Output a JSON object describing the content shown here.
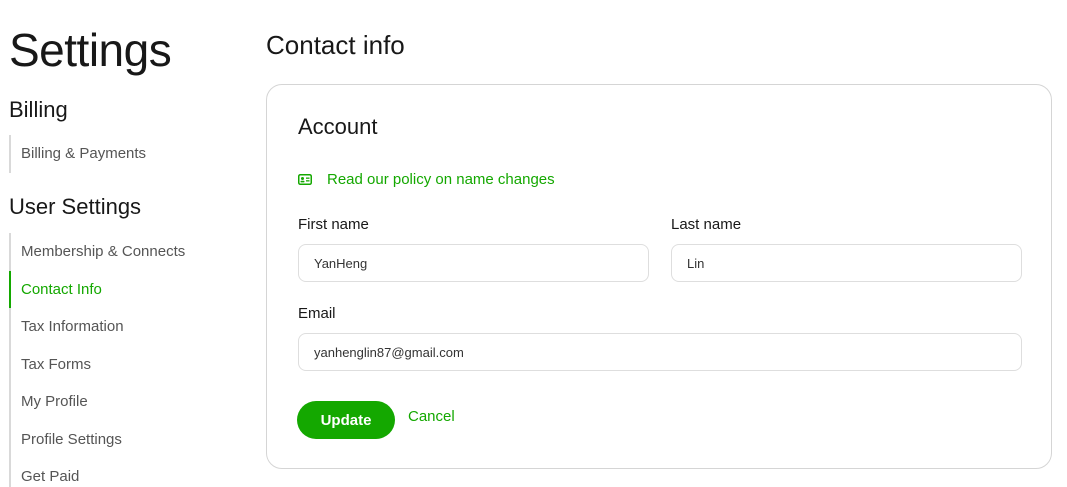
{
  "sidebar": {
    "title": "Settings",
    "billing_heading": "Billing",
    "billing_items": [
      {
        "label": "Billing & Payments"
      }
    ],
    "user_heading": "User Settings",
    "user_items": [
      {
        "label": "Membership & Connects"
      },
      {
        "label": "Contact Info"
      },
      {
        "label": "Tax Information"
      },
      {
        "label": "Tax Forms"
      },
      {
        "label": "My Profile"
      },
      {
        "label": "Profile Settings"
      },
      {
        "label": "Get Paid"
      }
    ],
    "active_item": "Contact Info"
  },
  "main": {
    "title": "Contact info",
    "card": {
      "title": "Account",
      "policy_link": "Read our policy on name changes",
      "policy_icon": "id-card-icon",
      "first_name": {
        "label": "First name",
        "value": "YanHeng"
      },
      "last_name": {
        "label": "Last name",
        "value": "Lin"
      },
      "email": {
        "label": "Email",
        "value": "yanhenglin87@gmail.com"
      },
      "update_label": "Update",
      "cancel_label": "Cancel"
    }
  },
  "colors": {
    "accent": "#14a800",
    "text": "#181818",
    "muted": "#555555",
    "border": "#d5d5d5"
  }
}
